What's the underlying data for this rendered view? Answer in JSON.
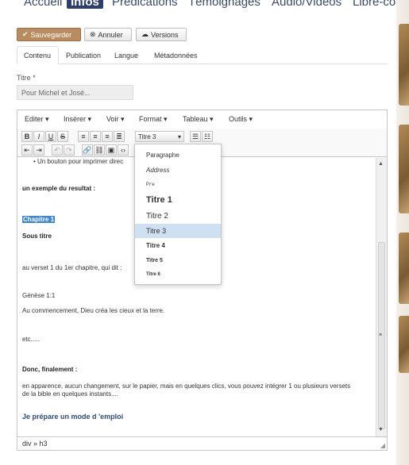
{
  "topnav": {
    "items": [
      "Accueil",
      "Infos",
      "Prédications",
      "Témoignages",
      "Audio/Vidéos",
      "Libre-cours"
    ],
    "active": "Infos"
  },
  "actions": {
    "save": "Sauvegarder",
    "cancel": "Annuler",
    "versions": "Versions"
  },
  "tabs": [
    "Contenu",
    "Publication",
    "Langue",
    "Métadonnées"
  ],
  "title_field": {
    "label": "Titre",
    "required_mark": "*",
    "value": "Pour Michel et José..."
  },
  "editor": {
    "menus": [
      "Editer",
      "Insérer",
      "Voir",
      "Format",
      "Tableau",
      "Outils"
    ],
    "format_select": "Titre 3",
    "content": {
      "truncated_bullet": "Un bouton pour imprimer direc",
      "line1": "un exemple du resultat :",
      "selected_heading": "Chapitre 1",
      "sous_titre": "Sous titre",
      "line2": "au verset 1 du 1er chapitre, qui dit :",
      "ref": "Génèse 1:1",
      "verse": "Au commencement, Dieu créa les cieux et la terre.",
      "etc": "etc.....",
      "donc": "Donc, finalement :",
      "para1": "en apparence, aucun changement, sur le papier, mais en quelques clics, vous pouvez intégrer 1 ou plusieurs versets",
      "para2": "de la bible en quelques instants....",
      "final": "Je prépare un mode d 'emploi"
    },
    "statusbar": "div » h3",
    "format_options": [
      "Paragraphe",
      "Address",
      "Pre",
      "Titre 1",
      "Titre 2",
      "Titre 3",
      "Titre 4",
      "Titre 5",
      "Titre 6"
    ],
    "highlighted_option": "Titre 3"
  }
}
